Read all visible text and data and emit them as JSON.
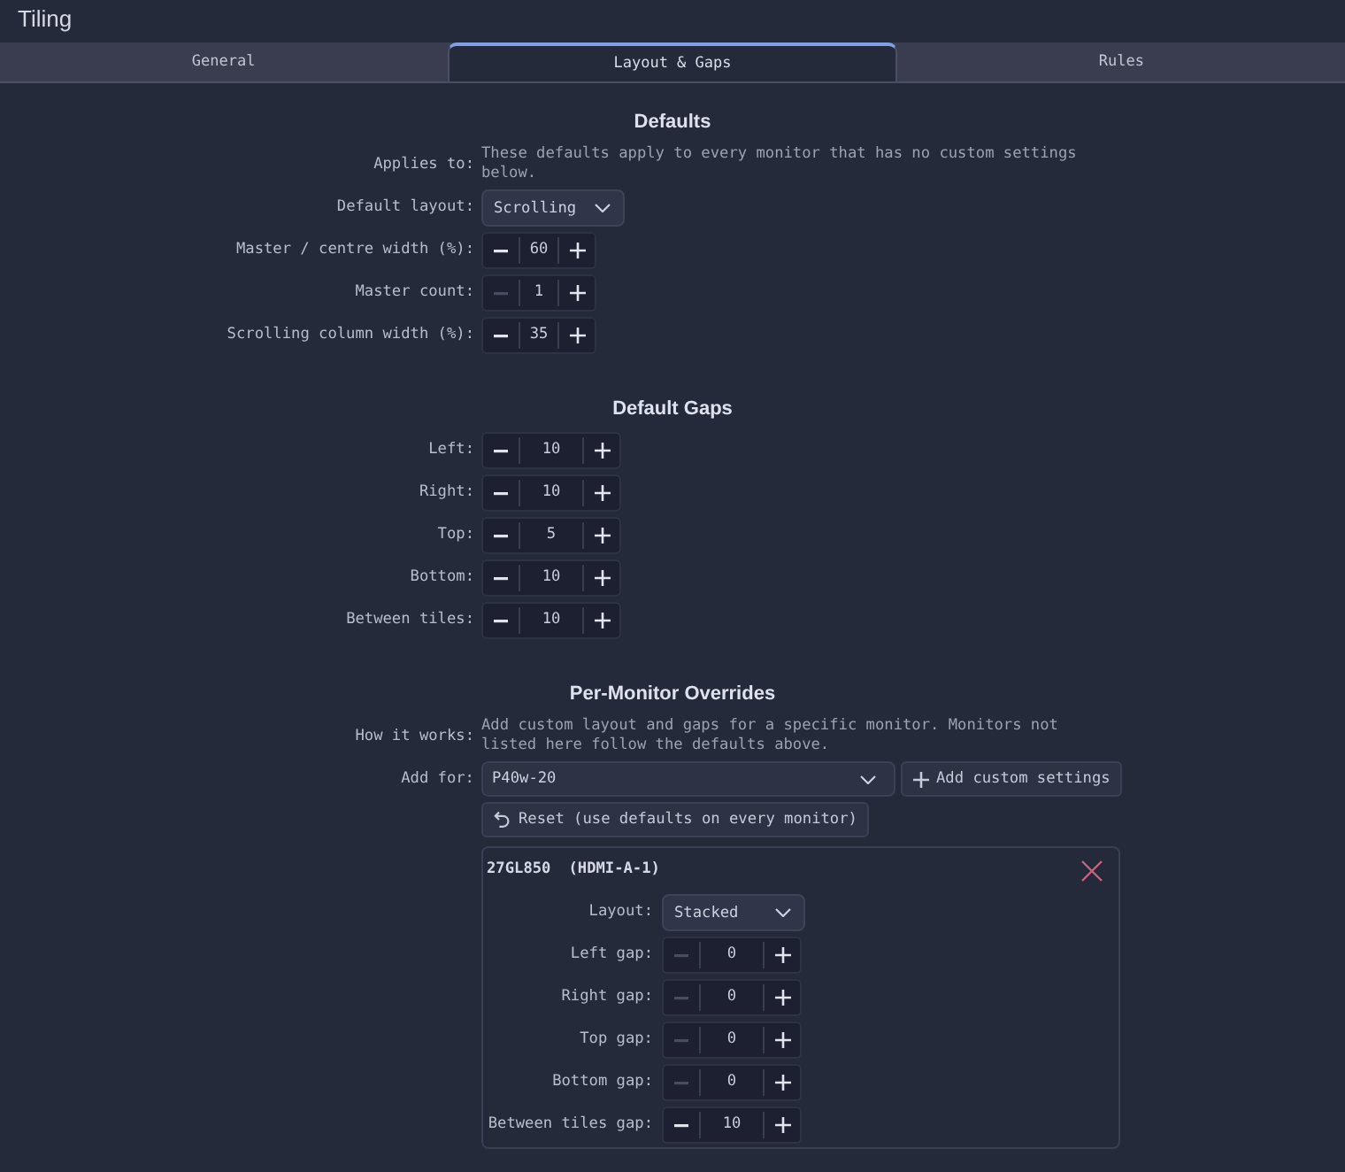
{
  "window": {
    "title": "Tiling"
  },
  "tabs": [
    {
      "label": "General",
      "selected": false
    },
    {
      "label": "Layout & Gaps",
      "selected": true
    },
    {
      "label": "Rules",
      "selected": false
    }
  ],
  "sections": [
    {
      "heading": "Defaults",
      "rows": [
        {
          "kind": "note",
          "label": "Applies to:",
          "text": "These defaults apply to every monitor that has no custom settings below."
        },
        {
          "kind": "dropdown",
          "label": "Default layout:",
          "value": "Scrolling"
        },
        {
          "kind": "spinner",
          "label": "Master / centre width (%):",
          "value": "60",
          "decrement_disabled": false
        },
        {
          "kind": "spinner",
          "label": "Master count:",
          "value": "1",
          "decrement_disabled": true
        },
        {
          "kind": "spinner",
          "label": "Scrolling column width (%):",
          "value": "35",
          "decrement_disabled": false
        }
      ]
    },
    {
      "heading": "Default Gaps",
      "rows": [
        {
          "kind": "spinner",
          "label": "Left:",
          "value": "10",
          "decrement_disabled": false
        },
        {
          "kind": "spinner",
          "label": "Right:",
          "value": "10",
          "decrement_disabled": false
        },
        {
          "kind": "spinner",
          "label": "Top:",
          "value": "5",
          "decrement_disabled": false
        },
        {
          "kind": "spinner",
          "label": "Bottom:",
          "value": "10",
          "decrement_disabled": false
        },
        {
          "kind": "spinner",
          "label": "Between tiles:",
          "value": "10",
          "decrement_disabled": false
        }
      ]
    },
    {
      "heading": "Per-Monitor Overrides",
      "rows": [
        {
          "kind": "note",
          "label": "How it works:",
          "text": "Add custom layout and gaps for a specific monitor. Monitors not listed here follow the defaults above."
        },
        {
          "kind": "picker",
          "label": "Add for:",
          "value": "P40w-20",
          "button": "Add custom settings"
        },
        {
          "kind": "reset",
          "button": "Reset (use defaults on every monitor)"
        },
        {
          "kind": "monitor",
          "name": "27GL850",
          "output": "(HDMI-A-1)",
          "rows": [
            {
              "kind": "dropdown",
              "label": "Layout:",
              "value": "Stacked"
            },
            {
              "kind": "spinner",
              "label": "Left gap:",
              "value": "0",
              "decrement_disabled": true
            },
            {
              "kind": "spinner",
              "label": "Right gap:",
              "value": "0",
              "decrement_disabled": true
            },
            {
              "kind": "spinner",
              "label": "Top gap:",
              "value": "0",
              "decrement_disabled": true
            },
            {
              "kind": "spinner",
              "label": "Bottom gap:",
              "value": "0",
              "decrement_disabled": true
            },
            {
              "kind": "spinner",
              "label": "Between tiles gap:",
              "value": "10",
              "decrement_disabled": false
            }
          ]
        }
      ]
    }
  ]
}
